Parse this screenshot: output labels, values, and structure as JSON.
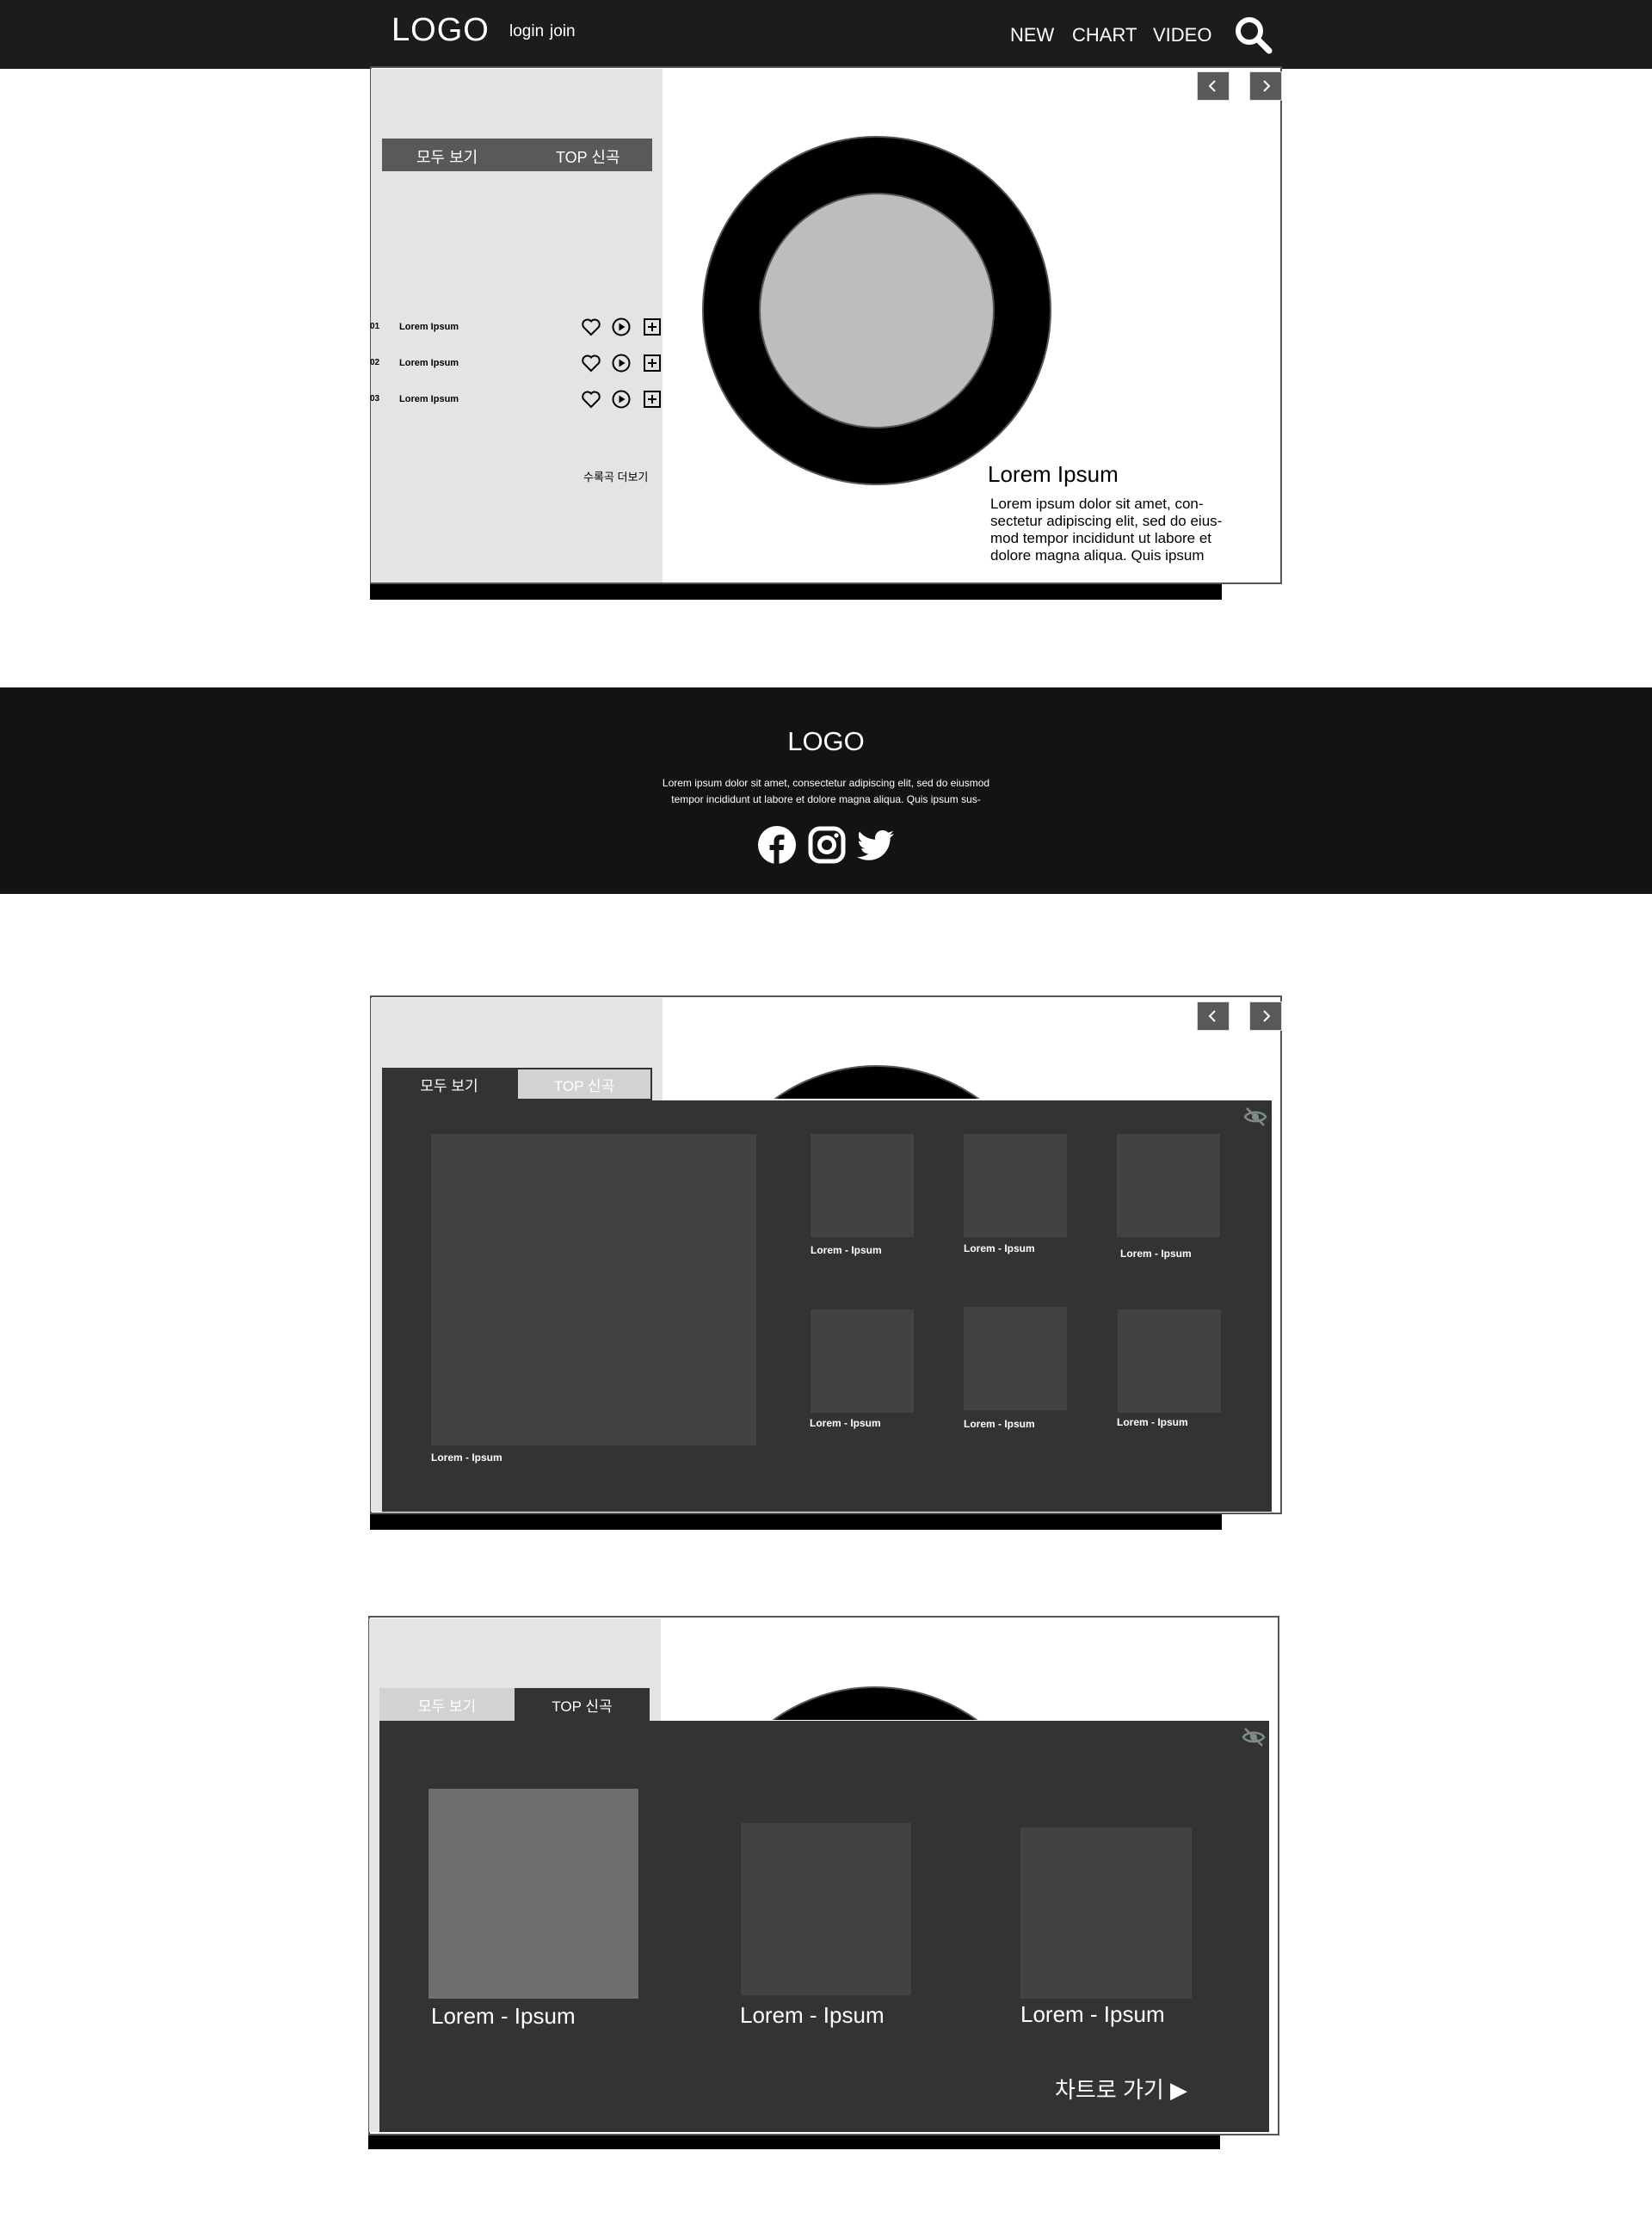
{
  "header": {
    "logo": "LOGO",
    "login": "login",
    "join": "join",
    "nav": [
      "NEW",
      "CHART",
      "VIDEO"
    ]
  },
  "player": {
    "tabs": [
      "모두 보기",
      "TOP 신곡"
    ],
    "songs": [
      {
        "num": "01",
        "title": "Lorem Ipsum"
      },
      {
        "num": "02",
        "title": "Lorem Ipsum"
      },
      {
        "num": "03",
        "title": "Lorem Ipsum"
      }
    ],
    "more": "수록곡 더보기",
    "album_title": "Lorem Ipsum",
    "album_desc_lines": [
      "Lorem ipsum dolor sit amet, con-",
      "sectetur adipiscing elit, sed do eius-",
      "mod tempor incididunt ut labore et",
      "dolore magna aliqua. Quis ipsum"
    ]
  },
  "footer": {
    "logo": "LOGO",
    "line1": "Lorem ipsum dolor sit amet, consectetur adipiscing elit, sed do eiusmod",
    "line2": "tempor incididunt ut labore et dolore magna aliqua. Quis ipsum sus-"
  },
  "all_view": {
    "tabs": [
      "모두 보기",
      "TOP 신곡"
    ],
    "feature_caption": "Lorem - Ipsum",
    "grid_captions": [
      "Lorem - Ipsum",
      "Lorem - Ipsum",
      "Lorem - Ipsum",
      "Lorem - Ipsum",
      "Lorem - Ipsum",
      "Lorem - Ipsum"
    ]
  },
  "top_new": {
    "tabs": [
      "모두 보기",
      "TOP 신곡"
    ],
    "captions": [
      "Lorem - Ipsum",
      "Lorem - Ipsum",
      "Lorem - Ipsum"
    ],
    "chart_link": "차트로 가기 ▶"
  },
  "icons": {
    "search": "search-icon",
    "prev": "chevron-left-icon",
    "next": "chevron-right-icon",
    "heart": "heart-icon",
    "play": "play-icon",
    "add": "plus-box-icon",
    "hide": "eye-off-icon",
    "facebook": "facebook-icon",
    "instagram": "instagram-icon",
    "twitter": "twitter-icon"
  },
  "colors": {
    "header_bg": "#1c1c1c",
    "footer_bg": "#131313",
    "panel_bg": "#333333",
    "thumb_bg": "#424242",
    "side_bg": "#e4e4e4",
    "tab_bg": "#595959"
  }
}
